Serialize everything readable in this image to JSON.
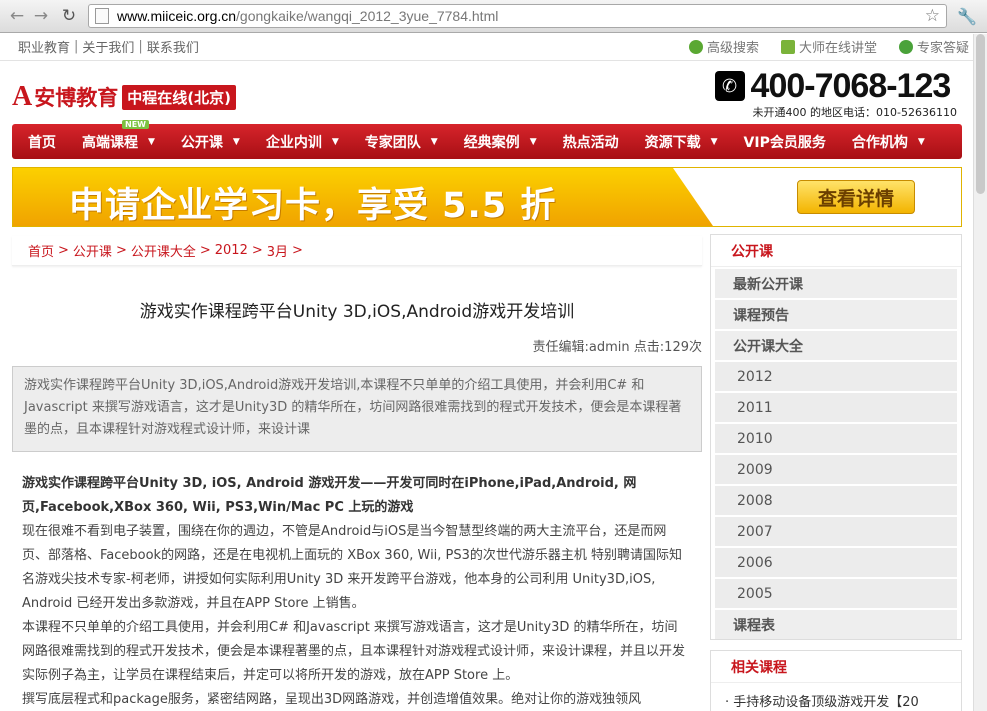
{
  "browser": {
    "url_host": "www.miiceic.org.cn",
    "url_path": "/gongkaike/wangqi_2012_3yue_7784.html"
  },
  "toplinks": {
    "left": [
      "职业教育",
      "关于我们",
      "联系我们"
    ],
    "right": [
      "高级搜索",
      "大师在线讲堂",
      "专家答疑"
    ]
  },
  "header": {
    "logo_mark": "A",
    "logo_name": "安博教育",
    "logo_sub": "中程在线(北京)",
    "phone": "400-7068-123",
    "phone_note": "未开通400 的地区电话：010-52636110"
  },
  "nav": {
    "new_tag": "NEW",
    "items": [
      "首页",
      "高端课程",
      "公开课",
      "企业内训",
      "专家团队",
      "经典案例",
      "热点活动",
      "资源下载",
      "VIP会员服务",
      "合作机构"
    ]
  },
  "banner": {
    "text": "申请企业学习卡，享受 5.5 折",
    "button": "查看详情"
  },
  "breadcrumb": [
    "首页",
    ">",
    "公开课",
    ">",
    "公开课大全",
    ">",
    "2012",
    ">",
    "3月",
    ">"
  ],
  "article": {
    "title": "游戏实作课程跨平台Unity 3D,iOS,Android游戏开发培训",
    "meta": "责任编辑:admin 点击:129次",
    "summary": "游戏实作课程跨平台Unity 3D,iOS,Android游戏开发培训,本课程不只单单的介绍工具使用，并会利用C# 和Javascript 来撰写游戏语言，这才是Unity3D 的精华所在，坊间网路很难需找到的程式开发技术，便会是本课程著墨的点，且本课程针对游戏程式设计师，来设计课",
    "lead": "游戏实作课程跨平台Unity 3D, iOS, Android 游戏开发——开发可同时在iPhone,iPad,Android, 网页,Facebook,XBox 360, Wii, PS3,Win/Mac PC 上玩的游戏",
    "p1": "现在很难不看到电子装置，围绕在你的週边，不管是Android与iOS是当今智慧型终端的两大主流平台，还是而网页、部落格、Facebook的网路，还是在电视机上面玩的 XBox 360, Wii, PS3的次世代游乐器主机 特别聘请国际知名游戏尖技术专家-柯老师，讲授如何实际利用Unity 3D 来开发跨平台游戏，他本身的公司利用 Unity3D,iOS, Android 已经开发出多款游戏，并且在APP Store 上销售。",
    "p2": "本课程不只单单的介绍工具使用，并会利用C# 和Javascript 来撰写游戏语言，这才是Unity3D 的精华所在，坊间网路很难需找到的程式开发技术，便会是本课程著墨的点，且本课程针对游戏程式设计师，来设计课程，并且以开发实际例子為主，让学员在课程结束后，并定可以将所开发的游戏，放在APP Store 上。",
    "p3": "撰写底层程式和package服务，紧密结网路，呈现出3D网路游戏，并创造增值效果。绝对让你的游戏独领风"
  },
  "sidebar": {
    "title": "公开课",
    "items": [
      "最新公开课",
      "课程预告",
      "公开课大全"
    ],
    "years": [
      "2012",
      "2011",
      "2010",
      "2009",
      "2008",
      "2007",
      "2006",
      "2005"
    ],
    "last": "课程表"
  },
  "related": {
    "title": "相关课程",
    "items": [
      "· 手持移动设备顶级游戏开发【20"
    ]
  }
}
